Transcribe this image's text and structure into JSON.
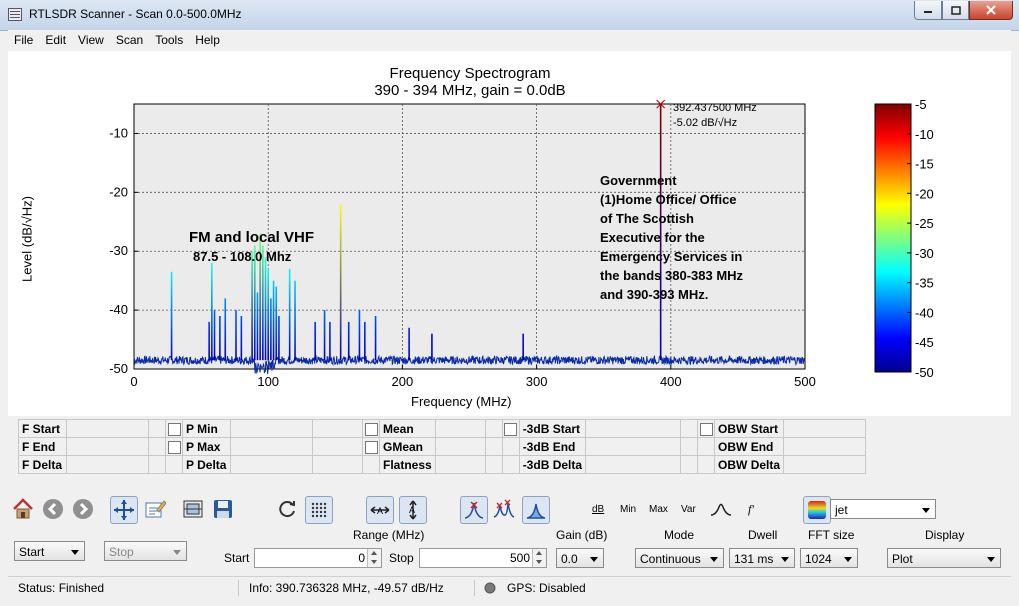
{
  "window": {
    "title": "RTLSDR Scanner - Scan 0.0-500.0MHz",
    "min_icon": "minimize-icon",
    "max_icon": "maximize-icon",
    "close_icon": "close-icon"
  },
  "menu": [
    "File",
    "Edit",
    "View",
    "Scan",
    "Tools",
    "Help"
  ],
  "chart_data": {
    "type": "line",
    "title": "Frequency Spectrogram",
    "subtitle": "390 - 394 MHz, gain = 0.0dB",
    "xlabel": "Frequency (MHz)",
    "ylabel": "Level (dB/√Hz)",
    "xlim": [
      0,
      500
    ],
    "ylim": [
      -50,
      -5
    ],
    "xticks": [
      "0",
      "100",
      "200",
      "300",
      "400",
      "500"
    ],
    "yticks": [
      "-10",
      "-20",
      "-30",
      "-40",
      "-50"
    ],
    "grid": true,
    "noise_floor": -48.5,
    "peaks": [
      {
        "x": 28,
        "y": -33.5
      },
      {
        "x": 56,
        "y": -42
      },
      {
        "x": 58,
        "y": -32
      },
      {
        "x": 60,
        "y": -40
      },
      {
        "x": 64,
        "y": -41
      },
      {
        "x": 68,
        "y": -38
      },
      {
        "x": 76,
        "y": -40
      },
      {
        "x": 80,
        "y": -41
      },
      {
        "x": 88,
        "y": -30
      },
      {
        "x": 90,
        "y": -29
      },
      {
        "x": 92,
        "y": -37
      },
      {
        "x": 94,
        "y": -27
      },
      {
        "x": 96,
        "y": -29
      },
      {
        "x": 98,
        "y": -31
      },
      {
        "x": 100,
        "y": -33
      },
      {
        "x": 102,
        "y": -38
      },
      {
        "x": 104,
        "y": -35
      },
      {
        "x": 106,
        "y": -36
      },
      {
        "x": 108,
        "y": -41
      },
      {
        "x": 116,
        "y": -33
      },
      {
        "x": 120,
        "y": -35
      },
      {
        "x": 135,
        "y": -42
      },
      {
        "x": 142,
        "y": -40
      },
      {
        "x": 146,
        "y": -42
      },
      {
        "x": 154,
        "y": -22
      },
      {
        "x": 160,
        "y": -42
      },
      {
        "x": 168,
        "y": -40
      },
      {
        "x": 172,
        "y": -42
      },
      {
        "x": 180,
        "y": -41
      },
      {
        "x": 205,
        "y": -43
      },
      {
        "x": 222,
        "y": -44
      },
      {
        "x": 290,
        "y": -44
      },
      {
        "x": 392.4375,
        "y": -5.02
      }
    ],
    "marker": {
      "freq_label": "392.437500 MHz",
      "level_label": "-5.02 dB/√Hz"
    },
    "colorbar": {
      "colormap": "jet",
      "range": [
        -50,
        -5
      ],
      "ticks": [
        "-5",
        "-10",
        "-15",
        "-20",
        "-25",
        "-30",
        "-35",
        "-40",
        "-45",
        "-50"
      ]
    },
    "annotations": {
      "fm_title": "FM and local VHF",
      "fm_range": "87.5 - 108.0 Mhz",
      "gov_lines": [
        "Government",
        "(1)Home Office/ Office",
        "of The Scottish",
        "Executive for the",
        "Emergency Services in",
        "the bands 380-383 MHz",
        "and 390-393 MHz."
      ]
    },
    "colors": {
      "trace": "#0a2aa8",
      "plot_bg": "#ebebeb",
      "marker": "#cc0000"
    }
  },
  "stats": {
    "col1": [
      "F Start",
      "F End",
      "F Delta"
    ],
    "col2": [
      "P Min",
      "P Max",
      "P Delta"
    ],
    "col3": [
      "Mean",
      "GMean",
      "Flatness"
    ],
    "col4": [
      "-3dB Start",
      "-3dB End",
      "-3dB Delta"
    ],
    "col5": [
      "OBW Start",
      "OBW End",
      "OBW Delta"
    ]
  },
  "toolbar": {
    "icons": [
      "home-icon",
      "back-icon",
      "forward-icon",
      "pan-icon",
      "edit-axis-icon",
      "configure-subplots-icon",
      "save-icon",
      "refresh-icon",
      "grid-icon",
      "zoom-x-icon",
      "zoom-y-icon",
      "peak-icon",
      "peaks-icon",
      "fill-icon",
      "smooth-icon",
      "diff-icon",
      "colormap-icon"
    ],
    "db_label": "dB",
    "min_label": "Min",
    "max_label": "Max",
    "var_label": "Var",
    "fprime_label": "f'",
    "colormap_value": "jet"
  },
  "controls": {
    "start_button": "Start",
    "stop_button": "Stop",
    "range_label": "Range (MHz)",
    "start_label": "Start",
    "start_value": "0",
    "stop_label": "Stop",
    "stop_value": "500",
    "gain_label": "Gain (dB)",
    "gain_value": "0.0",
    "mode_label": "Mode",
    "mode_value": "Continuous",
    "dwell_label": "Dwell",
    "dwell_value": "131 ms",
    "fft_label": "FFT size",
    "fft_value": "1024",
    "display_label": "Display",
    "display_value": "Plot"
  },
  "status": {
    "status": "Status: Finished",
    "info": "Info: 390.736328 MHz, -49.57 dB/Hz",
    "gps": "GPS: Disabled"
  }
}
